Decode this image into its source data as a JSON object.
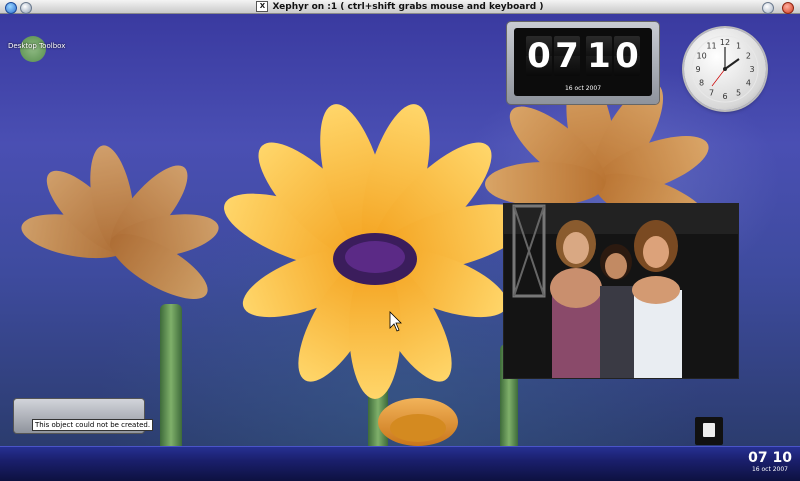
{
  "window": {
    "title": "Xephyr on :1 ( ctrl+shift grabs mouse and keyboard )"
  },
  "toolbox": {
    "label": "Desktop Toolbox"
  },
  "flip_clock": {
    "digits": [
      "0",
      "7",
      "1",
      "0"
    ],
    "date": "16 oct 2007"
  },
  "analog_clock": {
    "numbers": [
      "12",
      "1",
      "2",
      "3",
      "4",
      "5",
      "6",
      "7",
      "8",
      "9",
      "10",
      "11"
    ]
  },
  "error_widget": {
    "message": "This object could not be created."
  },
  "panel": {
    "time": "07 10",
    "date": "16 oct 2007"
  },
  "colors": {
    "panel": "#1a1f6c",
    "wallpaper_blue": "#4a4fb3",
    "petal": "#f6a52a"
  }
}
